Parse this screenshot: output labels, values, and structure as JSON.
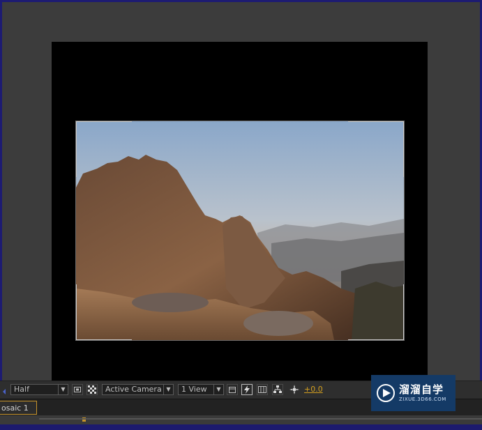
{
  "viewer_toolbar": {
    "resolution": "Half",
    "view_camera": "Active Camera",
    "view_layout": "1 View",
    "exposure": "+0.0"
  },
  "tab": {
    "label": "osaic 1",
    "close": "×"
  },
  "watermark": {
    "brand": "溜溜自学",
    "url": "ZIXUE.3D66.COM"
  },
  "colors": {
    "accent": "#c7932a",
    "exposure": "#d4a020"
  }
}
